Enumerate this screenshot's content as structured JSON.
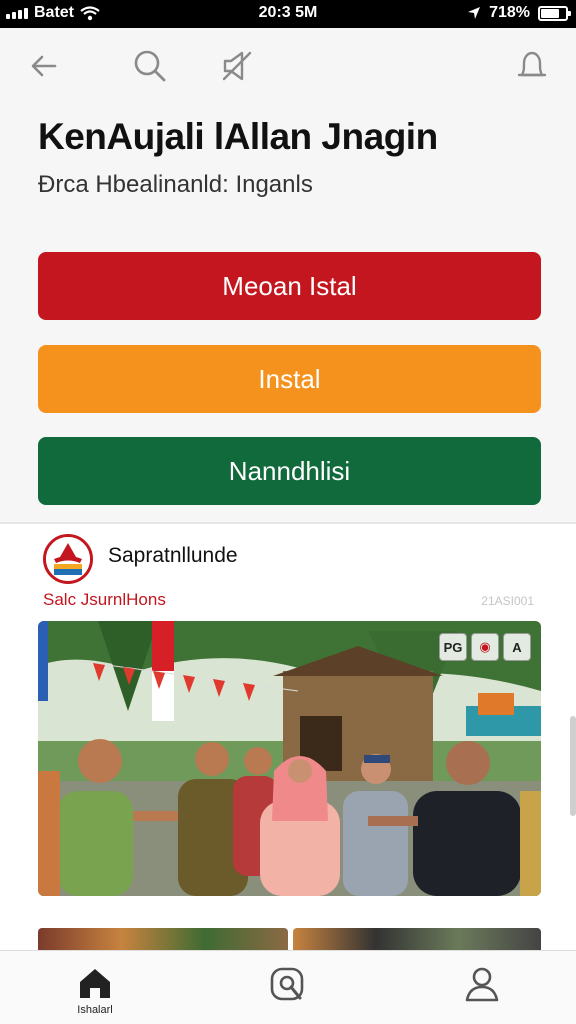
{
  "status_bar": {
    "carrier": "Batet",
    "time": "20:3 5M",
    "battery": "718%"
  },
  "nav": {
    "back_icon": "arrow-left-icon",
    "search_icon": "search-icon",
    "mute_icon": "speaker-off-icon",
    "notification_icon": "bell-icon"
  },
  "header": {
    "title": "KenAujali lAllan Jnagin",
    "subtitle": "Đrca Hbealinanld: Inganls"
  },
  "actions": {
    "primary_label": "Meoan Istal",
    "secondary_label": "Instal",
    "tertiary_label": "Nanndhlisi"
  },
  "post": {
    "author": "Sapratnllunde",
    "subtitle": "Salc JsurnlHons",
    "date": "21ASI001",
    "photo_badges": [
      "PG",
      "◉",
      "A"
    ]
  },
  "tabs": [
    {
      "icon": "home-icon",
      "label": "Ishalarl"
    },
    {
      "icon": "search-icon",
      "label": ""
    },
    {
      "icon": "user-icon",
      "label": ""
    }
  ],
  "colors": {
    "red": "#c3161f",
    "orange": "#f5921e",
    "green": "#106a3b"
  }
}
